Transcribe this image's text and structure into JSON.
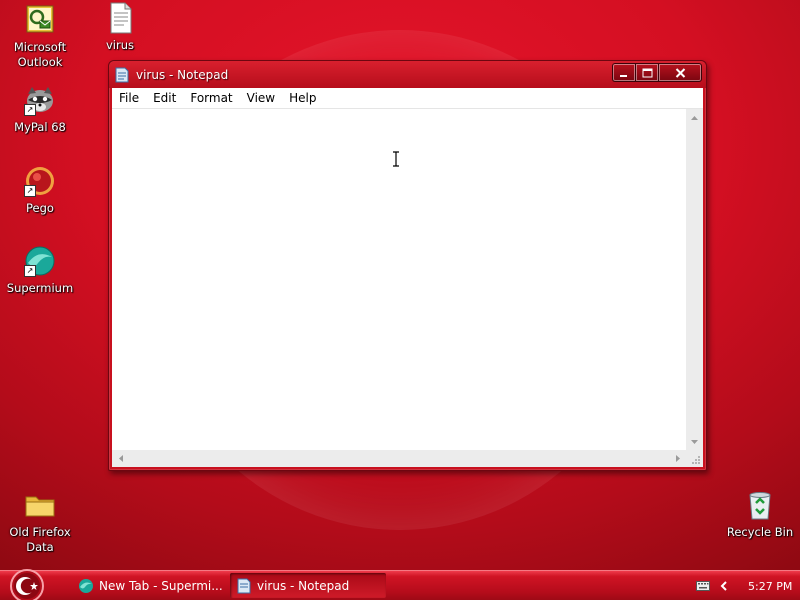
{
  "desktop": {
    "icons": [
      {
        "label_line1": "Microsoft",
        "label_line2": "Outlook",
        "icon": "outlook-icon"
      },
      {
        "label_line1": "virus",
        "label_line2": "",
        "icon": "text-document-icon"
      },
      {
        "label_line1": "MyPal 68",
        "label_line2": "",
        "icon": "mypal-raccoon-icon"
      },
      {
        "label_line1": "Pego",
        "label_line2": "",
        "icon": "pego-icon"
      },
      {
        "label_line1": "Supermium",
        "label_line2": "",
        "icon": "supermium-icon"
      },
      {
        "label_line1": "Old Firefox",
        "label_line2": "Data",
        "icon": "folder-icon"
      },
      {
        "label_line1": "Recycle Bin",
        "label_line2": "",
        "icon": "recycle-bin-icon"
      }
    ]
  },
  "notepad": {
    "title": "virus - Notepad",
    "menu": [
      "File",
      "Edit",
      "Format",
      "View",
      "Help"
    ],
    "content": ""
  },
  "taskbar": {
    "tasks": [
      {
        "label": "New Tab - Supermi...",
        "icon": "supermium-icon",
        "active": false
      },
      {
        "label": "virus - Notepad",
        "icon": "notepad-icon",
        "active": true
      }
    ],
    "clock": "5:27 PM"
  },
  "colors": {
    "desktop_red": "#d40f22",
    "taskbar_red": "#c0101f",
    "window_frame": "#c8101e"
  }
}
